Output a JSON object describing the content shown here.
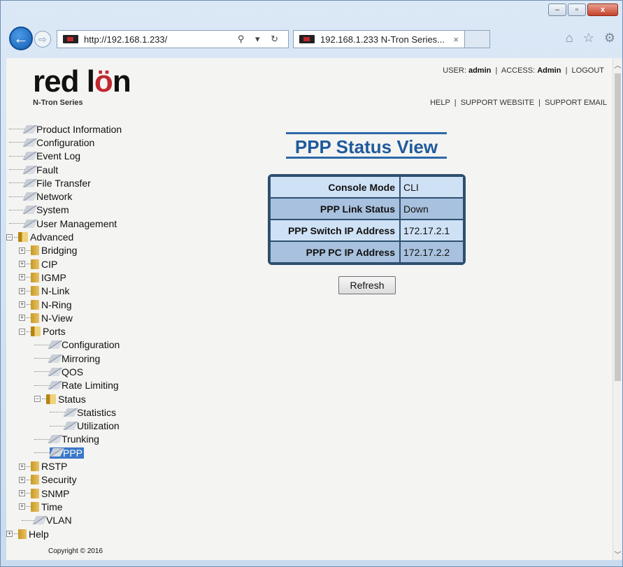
{
  "browser": {
    "url": "http://192.168.1.233/",
    "tab_title": "192.168.1.233 N-Tron Series...",
    "tab_close": "×",
    "window_controls": {
      "minimize": "–",
      "maximize": "▫",
      "close": "x"
    },
    "nav_icons": [
      "home-icon",
      "star-icon",
      "gear-icon"
    ]
  },
  "header": {
    "logo_text_a": "red l",
    "logo_text_b": "ö",
    "logo_text_c": "n",
    "logo_sub": "N-Tron Series",
    "user_label": "USER:",
    "user_value": "admin",
    "access_label": "ACCESS:",
    "access_value": "Admin",
    "logout": "LOGOUT",
    "help": "HELP",
    "support_website": "SUPPORT WEBSITE",
    "support_email": "SUPPORT EMAIL"
  },
  "tree": {
    "product_information": "Product Information",
    "configuration": "Configuration",
    "event_log": "Event Log",
    "fault": "Fault",
    "file_transfer": "File Transfer",
    "network": "Network",
    "system": "System",
    "user_management": "User Management",
    "advanced": "Advanced",
    "bridging": "Bridging",
    "cip": "CIP",
    "igmp": "IGMP",
    "nlink": "N-Link",
    "nring": "N-Ring",
    "nview": "N-View",
    "ports": "Ports",
    "ports_configuration": "Configuration",
    "ports_mirroring": "Mirroring",
    "ports_qos": "QOS",
    "ports_rate_limiting": "Rate Limiting",
    "ports_status": "Status",
    "status_statistics": "Statistics",
    "status_utilization": "Utilization",
    "ports_trunking": "Trunking",
    "ports_ppp": "PPP",
    "rstp": "RSTP",
    "security": "Security",
    "snmp": "SNMP",
    "time": "Time",
    "vlan": "VLAN",
    "help": "Help"
  },
  "copyright": "Copyright © 2016",
  "main": {
    "title": "PPP Status View",
    "rows": [
      {
        "label": "Console Mode",
        "value": "CLI"
      },
      {
        "label": "PPP Link Status",
        "value": "Down"
      },
      {
        "label": "PPP Switch IP Address",
        "value": "172.17.2.1"
      },
      {
        "label": "PPP PC IP Address",
        "value": "172.17.2.2"
      }
    ],
    "refresh_label": "Refresh"
  }
}
